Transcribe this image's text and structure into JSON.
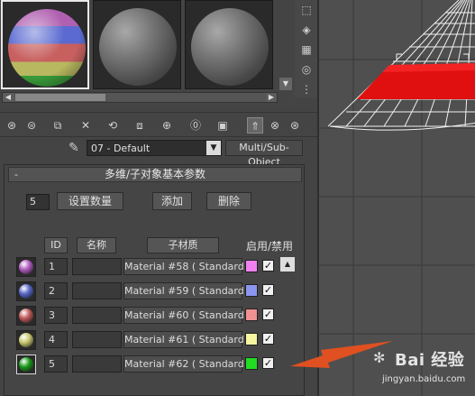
{
  "sample_slots": [
    {
      "type": "multi"
    },
    {
      "type": "gray"
    },
    {
      "type": "gray"
    }
  ],
  "material_name": "07 - Default",
  "material_type": "Multi/Sub-Object",
  "rollout": {
    "toggle": "-",
    "title": "多维/子对象基本参数",
    "count": "5",
    "set_number_label": "设置数量",
    "add_label": "添加",
    "delete_label": "删除"
  },
  "columns": {
    "id": "ID",
    "name": "名称",
    "sub_material": "子材质",
    "on_off": "启用/禁用"
  },
  "rows": [
    {
      "id": "1",
      "sub_material": "Material #58  ( Standard )",
      "color": "#f080f0",
      "enabled": "✓",
      "ball_color": "#b05cc0"
    },
    {
      "id": "2",
      "sub_material": "Material #59  ( Standard )",
      "color": "#8a96f0",
      "enabled": "✓",
      "ball_color": "#5868c8"
    },
    {
      "id": "3",
      "sub_material": "Material #60  ( Standard )",
      "color": "#f09090",
      "enabled": "✓",
      "ball_color": "#c05a5a"
    },
    {
      "id": "4",
      "sub_material": "Material #61  ( Standard )",
      "color": "#f6f6a0",
      "enabled": "✓",
      "ball_color": "#c8c870"
    },
    {
      "id": "5",
      "sub_material": "Material #62  ( Standard )",
      "color": "#22dd22",
      "enabled": "✓",
      "ball_color": "#1a9a1a"
    }
  ],
  "watermark": {
    "brand": "Baiص经验",
    "brand_text": "Bai 经验",
    "url": "jingyan.baidu.com"
  },
  "colors": {
    "viewport_red": "#e01010",
    "arrow": "#e05020"
  }
}
